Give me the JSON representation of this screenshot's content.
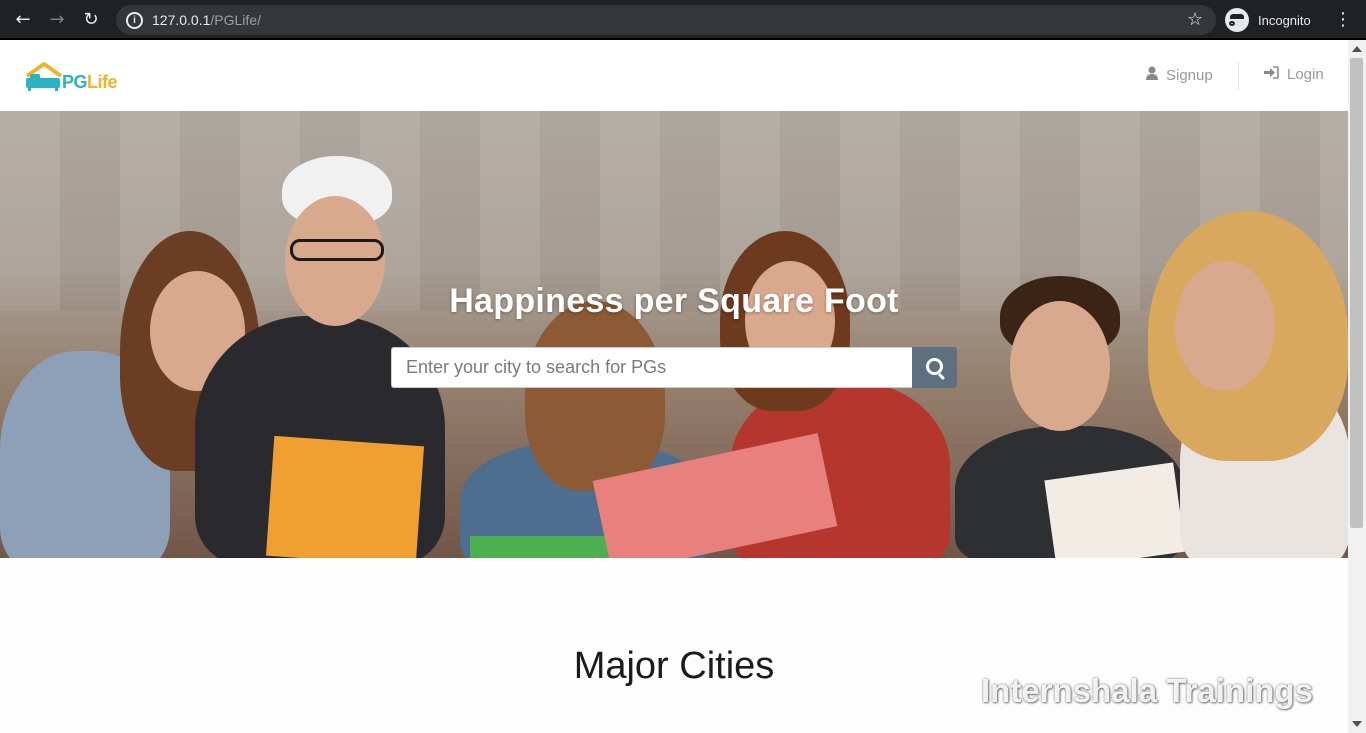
{
  "browser": {
    "back_icon": "back-arrow-icon",
    "forward_icon": "forward-arrow-icon",
    "reload_icon": "reload-icon",
    "url_host": "127.0.0.1",
    "url_path": "/PGLife/",
    "incognito_label": "Incognito"
  },
  "header": {
    "logo_pg": "PG",
    "logo_life": "Life",
    "signup_label": "Signup",
    "login_label": "Login"
  },
  "hero": {
    "title": "Happiness per Square Foot",
    "search_placeholder": "Enter your city to search for PGs",
    "search_value": ""
  },
  "main": {
    "section_title": "Major Cities"
  },
  "overlay": {
    "watermark": "Internshala Trainings"
  },
  "colors": {
    "browser_bg": "#202124",
    "logo_teal": "#2bb3c0",
    "logo_yellow": "#f0b429",
    "search_button": "#5e6f7f"
  }
}
